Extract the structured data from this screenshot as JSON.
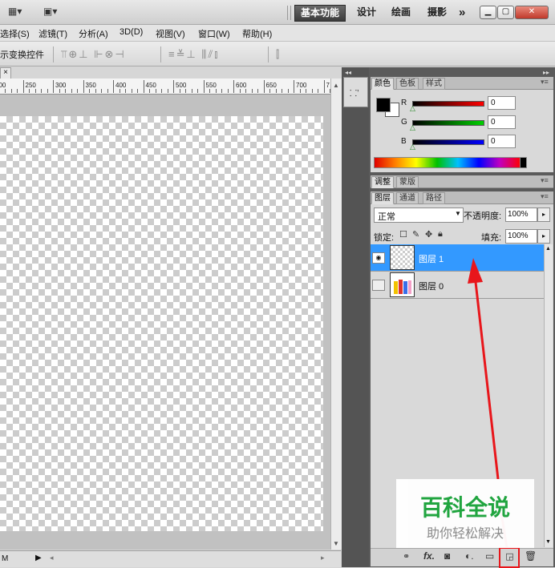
{
  "topbar": {
    "workspaces": [
      "基本功能",
      "设计",
      "绘画",
      "摄影"
    ],
    "more": "»"
  },
  "menu": [
    "选择(S)",
    "滤镜(T)",
    "分析(A)",
    "3D(D)",
    "视图(V)",
    "窗口(W)",
    "帮助(H)"
  ],
  "options": {
    "label": "示变换控件"
  },
  "document": {
    "tab_close": "×",
    "ruler_ticks": [
      "200",
      "250",
      "300",
      "350",
      "400",
      "450",
      "500",
      "550",
      "600",
      "650",
      "700",
      "7"
    ],
    "status_left": "M"
  },
  "color_panel": {
    "tabs": [
      "颜色",
      "色板",
      "样式"
    ],
    "r_label": "R",
    "g_label": "G",
    "b_label": "B",
    "r_value": "0",
    "g_value": "0",
    "b_value": "0"
  },
  "adjust_panel": {
    "tabs": [
      "调整",
      "蒙版"
    ]
  },
  "layers_panel": {
    "tabs": [
      "图层",
      "通道",
      "路径"
    ],
    "blend_mode": "正常",
    "opacity_label": "不透明度:",
    "opacity_value": "100%",
    "lock_label": "锁定:",
    "fill_label": "填充:",
    "fill_value": "100%",
    "layers": [
      {
        "name": "图层 1",
        "selected": true
      },
      {
        "name": "图层 0",
        "selected": false
      }
    ],
    "bottom_icons": [
      "link-icon",
      "fx-icon",
      "mask-icon",
      "adjustment-icon",
      "folder-icon",
      "new-layer-icon",
      "trash-icon"
    ]
  },
  "watermark": {
    "title": "百科全说",
    "subtitle": "助你轻松解决"
  },
  "colors": {
    "selection": "#3399ff",
    "arrow": "#e8161b",
    "watermark": "#1aa33a"
  }
}
